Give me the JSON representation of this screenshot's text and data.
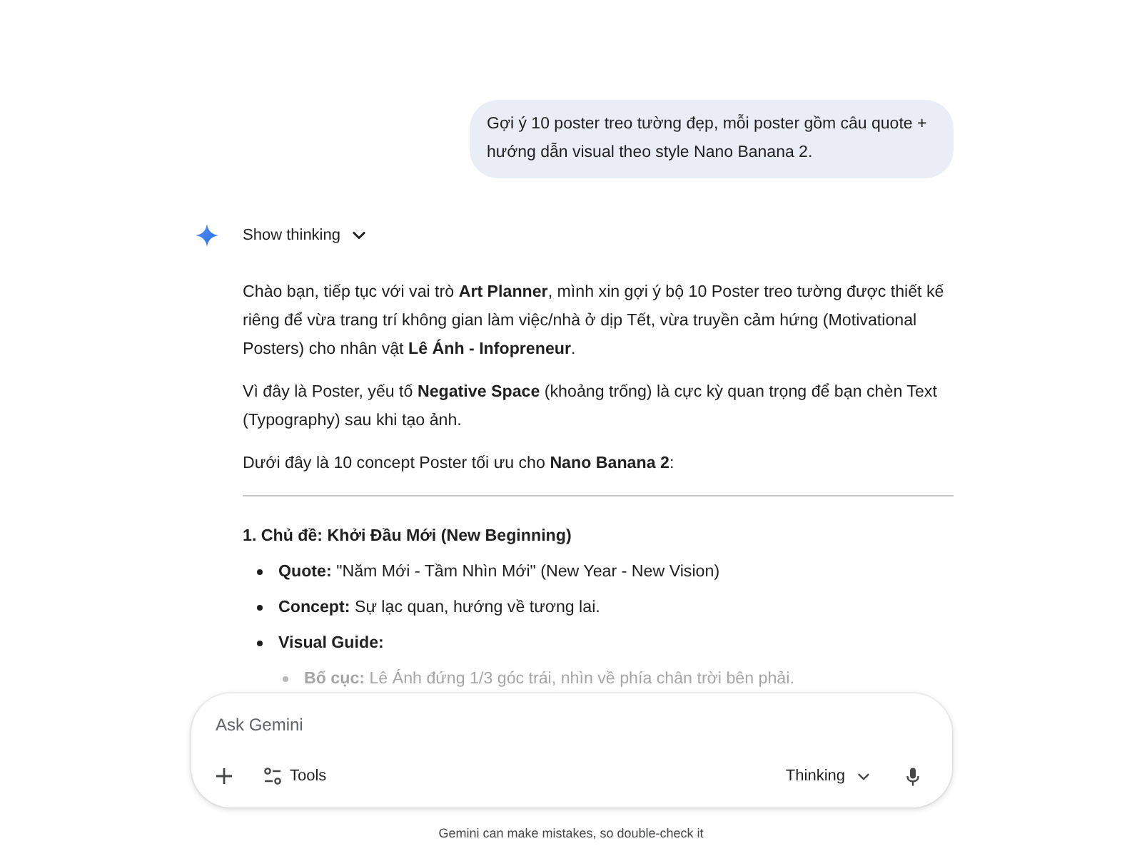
{
  "user_message": {
    "text": "Gợi ý 10 poster treo tường đẹp, mỗi poster gồm câu quote + hướng dẫn visual theo style Nano Banana 2."
  },
  "response": {
    "thinking_toggle": {
      "label": "Show thinking",
      "expanded": false
    },
    "paragraphs": [
      "Chào bạn, tiếp tục với vai trò **Art Planner**, mình xin gợi ý bộ 10 Poster treo tường được thiết kế riêng để vừa trang trí không gian làm việc/nhà ở dịp Tết, vừa truyền cảm hứng (Motivational Posters) cho nhân vật **Lê Ánh - Infopreneur**.",
      "Vì đây là Poster, yếu tố **Negative Space** (khoảng trống) là cực kỳ quan trọng để bạn chèn Text (Typography) sau khi tạo ảnh.",
      "Dưới đây là 10 concept Poster tối ưu cho **Nano Banana 2**:"
    ],
    "sections": [
      {
        "heading": "1. Chủ đề: Khởi Đầu Mới (New Beginning)",
        "bullets": [
          {
            "text": "**Quote:** \"Năm Mới - Tầm Nhìn Mới\" (New Year - New Vision)"
          },
          {
            "text": "**Concept:** Sự lạc quan, hướng về tương lai."
          },
          {
            "text": "**Visual Guide:**",
            "children": [
              {
                "text": "**Bố cục:** Lê Ánh đứng 1/3 góc trái, nhìn về phía chân trời bên phải."
              }
            ]
          }
        ]
      }
    ]
  },
  "composer": {
    "placeholder": "Ask Gemini",
    "tools_label": "Tools",
    "mode_label": "Thinking"
  },
  "disclaimer": "Gemini can make mistakes, so double-check it"
}
